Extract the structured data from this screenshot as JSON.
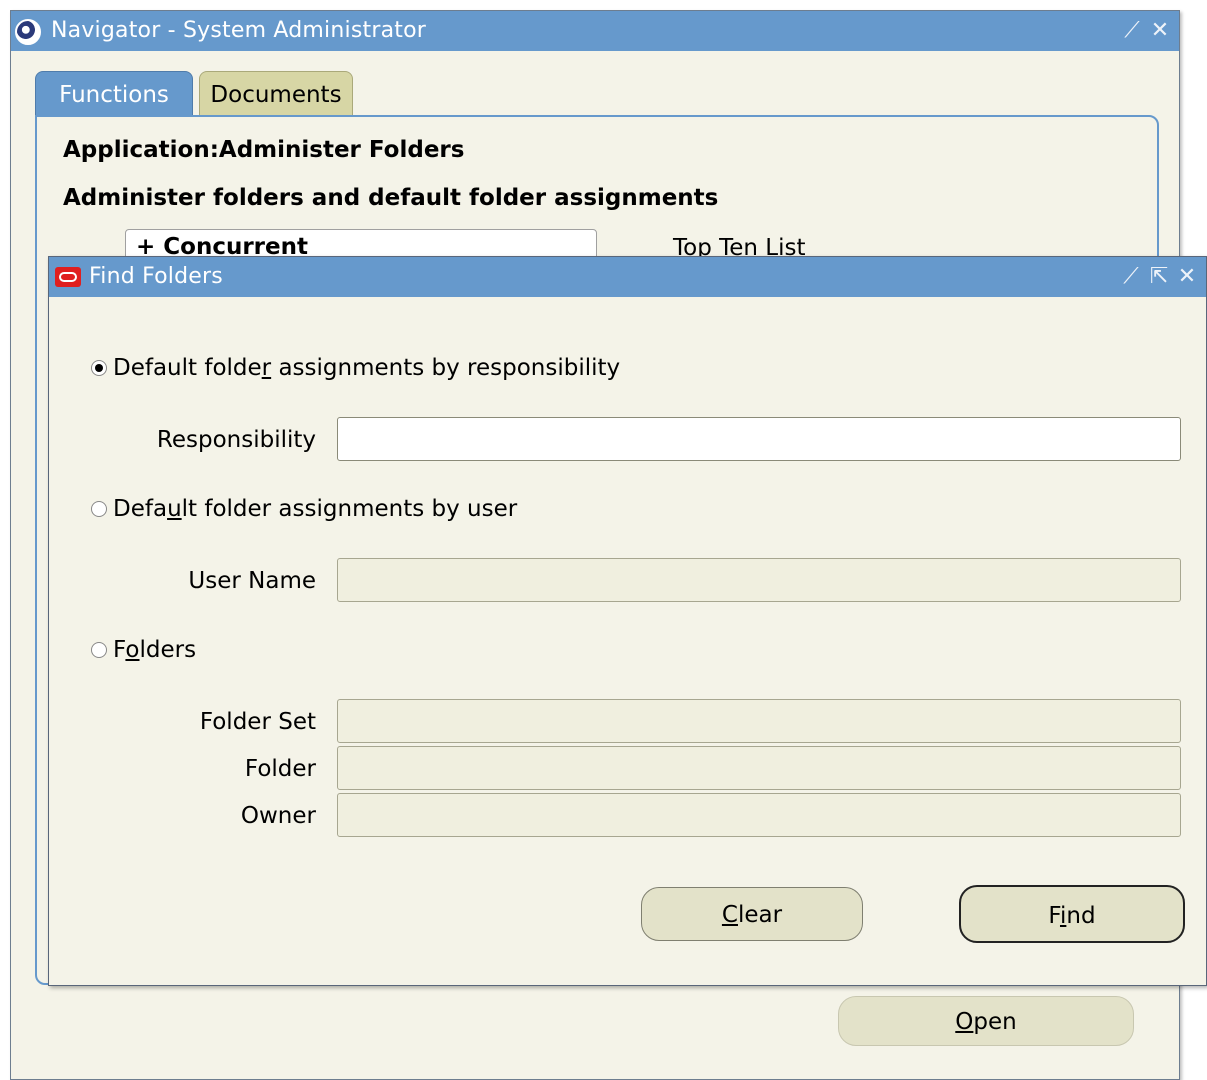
{
  "navigator": {
    "title": "Navigator - System Administrator",
    "controls": [
      "minimize-icon",
      "close-icon"
    ],
    "tabs": [
      {
        "label": "Functions",
        "active": true
      },
      {
        "label": "Documents",
        "active": false
      }
    ],
    "application_line": "Application:Administer Folders",
    "description_line": "Administer folders and default folder assignments",
    "tree_item": "+ Concurrent",
    "top_ten_label": "Top Ten List",
    "open_button": {
      "mnemonic": "O",
      "rest": "pen"
    }
  },
  "find_folders": {
    "title": "Find Folders",
    "controls": [
      "minimize-icon",
      "maximize-icon",
      "close-icon"
    ],
    "options": [
      {
        "pre": "Default folde",
        "mnemonic": "r",
        "post": " assignments by responsibility",
        "selected": true
      },
      {
        "pre": "Defa",
        "mnemonic": "u",
        "post": "lt folder assignments by user",
        "selected": false
      },
      {
        "pre": "F",
        "mnemonic": "o",
        "post": "lders",
        "selected": false
      }
    ],
    "fields": {
      "responsibility": {
        "label": "Responsibility",
        "value": ""
      },
      "user_name": {
        "label": "User Name",
        "value": ""
      },
      "folder_set": {
        "label": "Folder Set",
        "value": ""
      },
      "folder": {
        "label": "Folder",
        "value": ""
      },
      "owner": {
        "label": "Owner",
        "value": ""
      }
    },
    "clear_button": {
      "mnemonic": "C",
      "rest": "lear"
    },
    "find_button": {
      "pre": "F",
      "mnemonic": "i",
      "post": "nd"
    }
  },
  "colors": {
    "titlebar": "#6699cc",
    "window_bg": "#f4f3e8",
    "button_bg": "#e3e2c9",
    "documents_tab": "#d7d6a5"
  }
}
